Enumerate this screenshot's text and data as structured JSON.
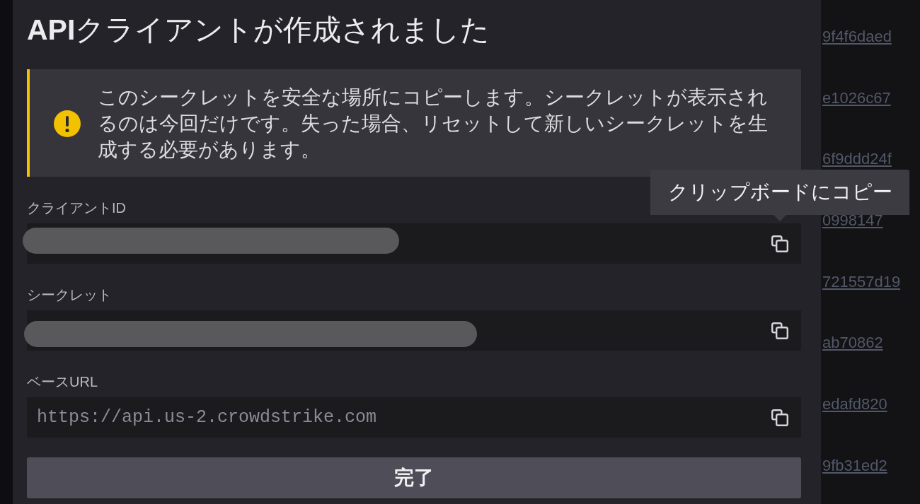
{
  "dialog": {
    "title": "**API**クライアントが作成されました",
    "warning": {
      "text": "このシークレットを安全な場所にコピーします。シークレットが表示されるのは今回だけです。失った場合、リセットして新しいシークレットを生成する必要があります。"
    },
    "fields": [
      {
        "label": "クライアントID",
        "kind": "redacted",
        "copy_tooltip": "クリップボードにコピー"
      },
      {
        "label": "シークレット",
        "kind": "redacted"
      },
      {
        "label": "ベースURL",
        "kind": "text",
        "value": "https://api.us-2.crowdstrike.com"
      }
    ],
    "done_button": "完了"
  },
  "background_links": [
    "9f4f6daed",
    "e1026c67",
    "6f9ddd24f",
    "0998147",
    "721557d19",
    "ab70862",
    "edafd820",
    "9fb31ed2"
  ]
}
